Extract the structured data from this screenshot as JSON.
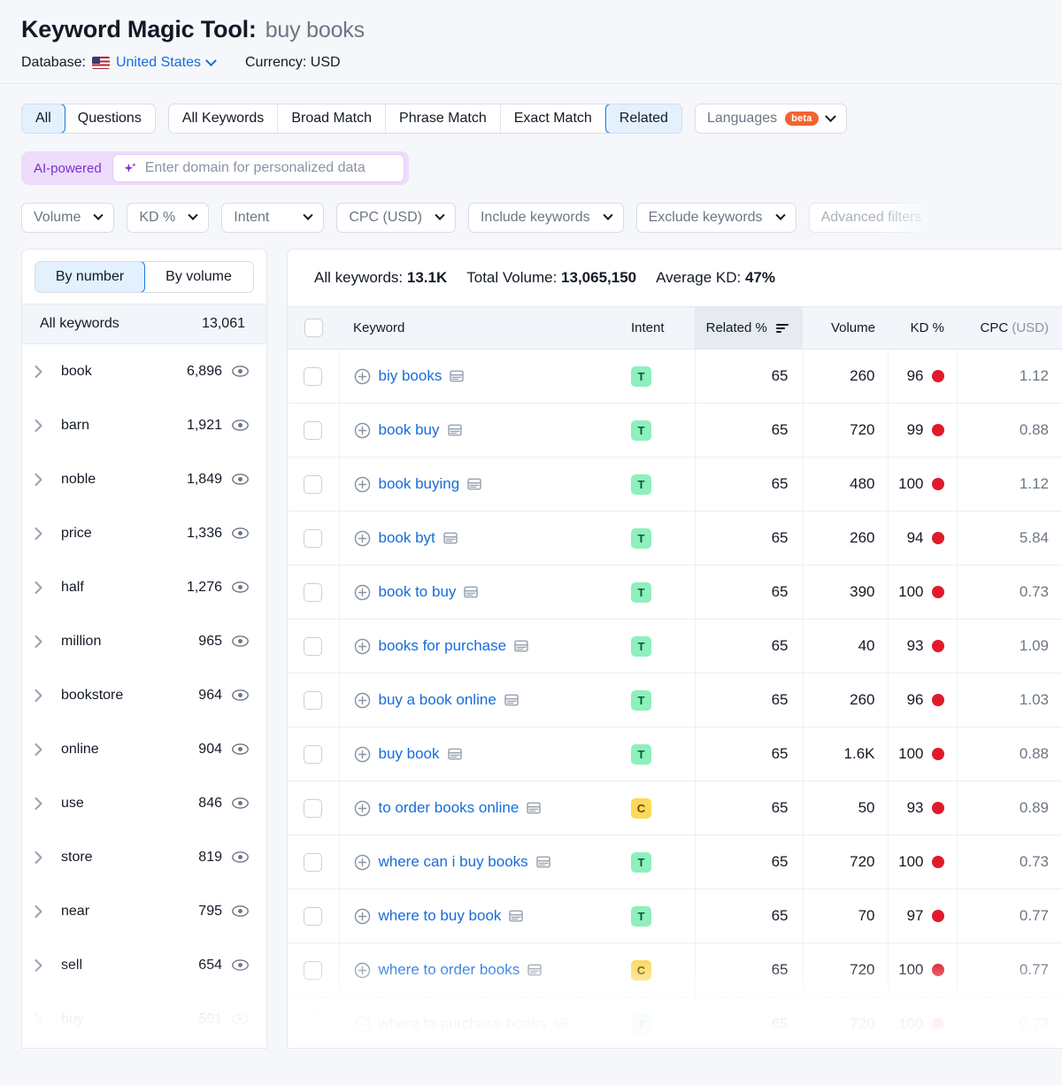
{
  "header": {
    "tool_title": "Keyword Magic Tool:",
    "keyword": "buy books",
    "database_label": "Database:",
    "database_value": "United States",
    "currency_label": "Currency: USD",
    "flag_icon": "us-flag-icon"
  },
  "match_tabs": {
    "group_one": [
      {
        "label": "All",
        "active": true
      },
      {
        "label": "Questions",
        "active": false
      }
    ],
    "group_two": [
      {
        "label": "All Keywords",
        "active": false
      },
      {
        "label": "Broad Match",
        "active": false
      },
      {
        "label": "Phrase Match",
        "active": false
      },
      {
        "label": "Exact Match",
        "active": false
      },
      {
        "label": "Related",
        "active": true
      }
    ],
    "languages": {
      "label": "Languages",
      "badge": "beta"
    }
  },
  "ai_bar": {
    "label": "AI-powered",
    "placeholder": "Enter domain for personalized data",
    "sparkle_icon": "sparkle-icon"
  },
  "filters": [
    {
      "label": "Volume",
      "faded": false
    },
    {
      "label": "KD %",
      "faded": false
    },
    {
      "label": "Intent",
      "faded": false
    },
    {
      "label": "CPC (USD)",
      "faded": false
    },
    {
      "label": "Include keywords",
      "faded": false
    },
    {
      "label": "Exclude keywords",
      "faded": false
    },
    {
      "label": "Advanced filters",
      "faded": true
    }
  ],
  "sidebar": {
    "view_tabs": [
      {
        "label": "By number",
        "active": true
      },
      {
        "label": "By volume",
        "active": false
      }
    ],
    "all_keywords": {
      "label": "All keywords",
      "count": "13,061"
    },
    "groups": [
      {
        "label": "book",
        "count": "6,896"
      },
      {
        "label": "barn",
        "count": "1,921"
      },
      {
        "label": "noble",
        "count": "1,849"
      },
      {
        "label": "price",
        "count": "1,336"
      },
      {
        "label": "half",
        "count": "1,276"
      },
      {
        "label": "million",
        "count": "965"
      },
      {
        "label": "bookstore",
        "count": "964"
      },
      {
        "label": "online",
        "count": "904"
      },
      {
        "label": "use",
        "count": "846"
      },
      {
        "label": "store",
        "count": "819"
      },
      {
        "label": "near",
        "count": "795"
      },
      {
        "label": "sell",
        "count": "654"
      },
      {
        "label": "buy",
        "count": "591"
      }
    ]
  },
  "summary": {
    "all_keywords_label": "All keywords:",
    "all_keywords_value": "13.1K",
    "total_volume_label": "Total Volume:",
    "total_volume_value": "13,065,150",
    "average_kd_label": "Average KD:",
    "average_kd_value": "47%"
  },
  "table": {
    "columns": {
      "keyword": "Keyword",
      "intent": "Intent",
      "related": "Related %",
      "volume": "Volume",
      "kd": "KD %",
      "cpc_main": "CPC ",
      "cpc_unit": "(USD)"
    },
    "sorted_column": "related",
    "rows": [
      {
        "keyword": "biy books",
        "intent": "T",
        "related": "65",
        "volume": "260",
        "kd": "96",
        "cpc": "1.12"
      },
      {
        "keyword": "book buy",
        "intent": "T",
        "related": "65",
        "volume": "720",
        "kd": "99",
        "cpc": "0.88"
      },
      {
        "keyword": "book buying",
        "intent": "T",
        "related": "65",
        "volume": "480",
        "kd": "100",
        "cpc": "1.12"
      },
      {
        "keyword": "book byt",
        "intent": "T",
        "related": "65",
        "volume": "260",
        "kd": "94",
        "cpc": "5.84"
      },
      {
        "keyword": "book to buy",
        "intent": "T",
        "related": "65",
        "volume": "390",
        "kd": "100",
        "cpc": "0.73"
      },
      {
        "keyword": "books for purchase",
        "intent": "T",
        "related": "65",
        "volume": "40",
        "kd": "93",
        "cpc": "1.09"
      },
      {
        "keyword": "buy a book online",
        "intent": "T",
        "related": "65",
        "volume": "260",
        "kd": "96",
        "cpc": "1.03"
      },
      {
        "keyword": "buy book",
        "intent": "T",
        "related": "65",
        "volume": "1.6K",
        "kd": "100",
        "cpc": "0.88"
      },
      {
        "keyword": "to order books online",
        "intent": "C",
        "related": "65",
        "volume": "50",
        "kd": "93",
        "cpc": "0.89"
      },
      {
        "keyword": "where can i buy books",
        "intent": "T",
        "related": "65",
        "volume": "720",
        "kd": "100",
        "cpc": "0.73"
      },
      {
        "keyword": "where to buy book",
        "intent": "T",
        "related": "65",
        "volume": "70",
        "kd": "97",
        "cpc": "0.77"
      },
      {
        "keyword": "where to order books",
        "intent": "C",
        "related": "65",
        "volume": "720",
        "kd": "100",
        "cpc": "0.77"
      },
      {
        "keyword": "where to purchase books",
        "intent": "T",
        "related": "65",
        "volume": "720",
        "kd": "100",
        "cpc": "0.73"
      }
    ]
  },
  "colors": {
    "link": "#176cd9",
    "accent_blue": "#1f7ae0",
    "ai_purple": "#7a2fd0",
    "beta_orange": "#f3642c",
    "intent_t_bg": "#8ef0bc",
    "intent_c_bg": "#fcd95b",
    "kd_dot": "#e01a2b"
  }
}
